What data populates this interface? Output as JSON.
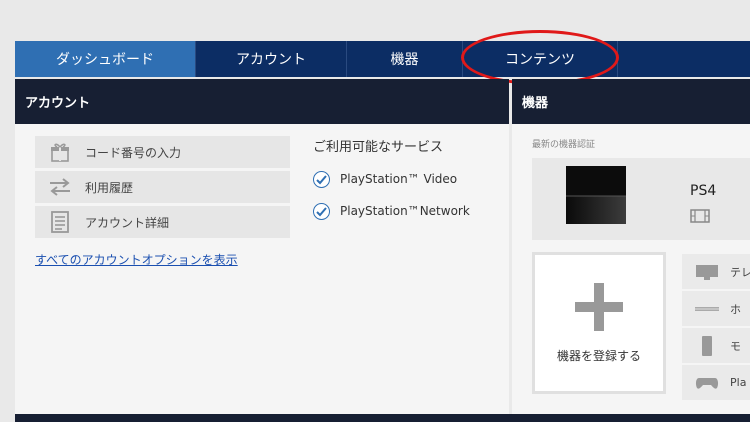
{
  "nav": {
    "tabs": [
      {
        "label": "ダッシュボード"
      },
      {
        "label": "アカウント"
      },
      {
        "label": "機器"
      },
      {
        "label": "コンテンツ"
      }
    ],
    "active_color": "#2f6fb3",
    "bar_color": "#0c2d64"
  },
  "account_panel": {
    "title": "アカウント",
    "menu": [
      {
        "label": "コード番号の入力",
        "icon": "gift-icon"
      },
      {
        "label": "利用履歴",
        "icon": "transfer-arrows-icon"
      },
      {
        "label": "アカウント詳細",
        "icon": "document-list-icon"
      }
    ],
    "all_options_link": "すべてのアカウントオプションを表示",
    "services": {
      "title": "ご利用可能なサービス",
      "items": [
        "PlayStation™ Video",
        "PlayStation™Network"
      ]
    }
  },
  "devices_panel": {
    "title": "機器",
    "recent_label": "最新の機器認証",
    "recent_device": {
      "name": "PS4",
      "icon": "film-icon"
    },
    "register_label": "機器を登録する",
    "device_types": [
      {
        "label": "テレ",
        "icon": "tv-icon"
      },
      {
        "label": "ホ",
        "icon": "home-theater-icon"
      },
      {
        "label": "モ",
        "icon": "mobile-icon"
      },
      {
        "label": "Pla",
        "icon": "gamepad-icon"
      }
    ]
  },
  "highlight_color": "#e01919"
}
